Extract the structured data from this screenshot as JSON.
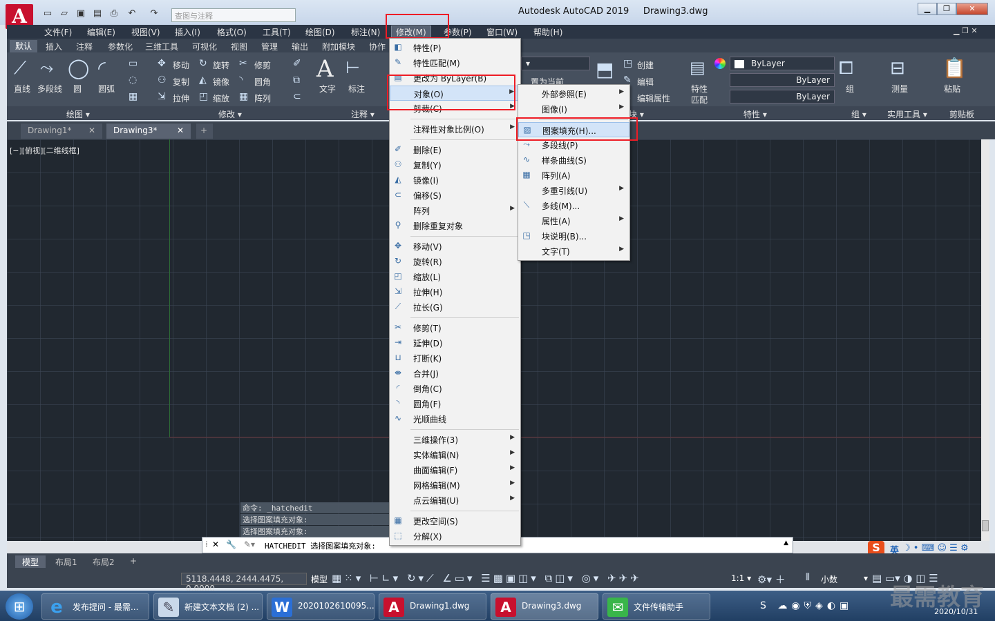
{
  "app": {
    "title": "Autodesk AutoCAD 2019",
    "file": "Drawing3.dwg",
    "search_placeholder": "查图与注释"
  },
  "menubar": [
    "文件(F)",
    "编辑(E)",
    "视图(V)",
    "插入(I)",
    "格式(O)",
    "工具(T)",
    "绘图(D)",
    "标注(N)",
    "修改(M)",
    "参数(P)",
    "窗口(W)",
    "帮助(H)"
  ],
  "ribbon_tabs": [
    "默认",
    "插入",
    "注释",
    "参数化",
    "三维工具",
    "可视化",
    "视图",
    "管理",
    "输出",
    "附加模块",
    "协作"
  ],
  "ribbon": {
    "draw": {
      "line": "直线",
      "pline": "多段线",
      "circle": "圆",
      "arc": "圆弧",
      "panel": "绘图"
    },
    "modify": {
      "move": "移动",
      "rotate": "旋转",
      "trim": "修剪",
      "copy": "复制",
      "mirror": "镜像",
      "fillet": "圆角",
      "stretch": "拉伸",
      "scale": "缩放",
      "array": "阵列",
      "panel": "修改"
    },
    "annotation": {
      "text": "文字",
      "dim": "标注",
      "panel": "注释"
    },
    "layer": {
      "setcurrent": "置为当前"
    },
    "block": {
      "create": "创建",
      "edit": "编辑",
      "editattr": "编辑属性",
      "panel": "块"
    },
    "props": {
      "match1": "特性",
      "match2": "匹配",
      "bylayer1": "ByLayer",
      "bylayer2": "ByLayer",
      "bylayer3": "ByLayer",
      "panel": "特性"
    },
    "group": {
      "group": "组",
      "panel": "组"
    },
    "utils": {
      "measure": "测量",
      "panel": "实用工具"
    },
    "clip": {
      "paste": "粘贴",
      "panel": "剪贴板"
    }
  },
  "doc_tabs": [
    "Drawing1*",
    "Drawing3*",
    "+"
  ],
  "viewport_label": "[−][俯视][二维线框]",
  "cmd_history": [
    "命令: _hatchedit",
    "选择图案填充对象:",
    "选择图案填充对象:"
  ],
  "cmd_input": "HATCHEDIT 选择图案填充对象:",
  "layout_tabs": [
    "模型",
    "布局1",
    "布局2",
    "+"
  ],
  "status": {
    "coords": "5118.4448, 2444.4475, 0.0000",
    "model": "模型",
    "scale": "1:1",
    "units": "小数"
  },
  "ime": {
    "lang": "英"
  },
  "taskbar": {
    "items": [
      "发布提问 - 最需...",
      "新建文本文档 (2) ...",
      "2020102610095...",
      "Drawing1.dwg",
      "Drawing3.dwg",
      "文件传输助手"
    ],
    "time": "2020/10/31"
  },
  "watermark": "最需教育",
  "modify_menu": {
    "items": [
      {
        "label": "特性(P)",
        "icon": "◧"
      },
      {
        "label": "特性匹配(M)",
        "icon": "✎"
      },
      {
        "label": "更改为 ByLayer(B)",
        "icon": "▤"
      },
      {
        "label": "对象(O)",
        "icon": "",
        "arrow": "▶"
      },
      {
        "label": "剪裁(C)",
        "icon": "",
        "arrow": "▶"
      },
      {
        "label": "注释性对象比例(O)",
        "icon": "",
        "arrow": "▶"
      },
      {
        "label": "删除(E)",
        "icon": "✐"
      },
      {
        "label": "复制(Y)",
        "icon": "⚇"
      },
      {
        "label": "镜像(I)",
        "icon": "◭"
      },
      {
        "label": "偏移(S)",
        "icon": "⊂"
      },
      {
        "label": "阵列",
        "icon": "",
        "arrow": "▶"
      },
      {
        "label": "删除重复对象",
        "icon": "⚲"
      },
      {
        "label": "移动(V)",
        "icon": "✥"
      },
      {
        "label": "旋转(R)",
        "icon": "↻"
      },
      {
        "label": "缩放(L)",
        "icon": "◰"
      },
      {
        "label": "拉伸(H)",
        "icon": "⇲"
      },
      {
        "label": "拉长(G)",
        "icon": "⟋"
      },
      {
        "label": "修剪(T)",
        "icon": "✂"
      },
      {
        "label": "延伸(D)",
        "icon": "⇥"
      },
      {
        "label": "打断(K)",
        "icon": "⊔"
      },
      {
        "label": "合并(J)",
        "icon": "⇼"
      },
      {
        "label": "倒角(C)",
        "icon": "◜"
      },
      {
        "label": "圆角(F)",
        "icon": "◝"
      },
      {
        "label": "光顺曲线",
        "icon": "∿"
      },
      {
        "label": "三维操作(3)",
        "icon": "",
        "arrow": "▶"
      },
      {
        "label": "实体编辑(N)",
        "icon": "",
        "arrow": "▶"
      },
      {
        "label": "曲面编辑(F)",
        "icon": "",
        "arrow": "▶"
      },
      {
        "label": "网格编辑(M)",
        "icon": "",
        "arrow": "▶"
      },
      {
        "label": "点云编辑(U)",
        "icon": "",
        "arrow": "▶"
      },
      {
        "label": "更改空间(S)",
        "icon": "▦"
      },
      {
        "label": "分解(X)",
        "icon": "⬚"
      }
    ]
  },
  "object_submenu": {
    "items": [
      {
        "label": "外部参照(E)",
        "icon": "",
        "arrow": "▶"
      },
      {
        "label": "图像(I)",
        "icon": "",
        "arrow": "▶"
      },
      {
        "label": "图案填充(H)...",
        "icon": "▨"
      },
      {
        "label": "多段线(P)",
        "icon": "⤳"
      },
      {
        "label": "样条曲线(S)",
        "icon": "∿"
      },
      {
        "label": "阵列(A)",
        "icon": "▦"
      },
      {
        "label": "多重引线(U)",
        "icon": "",
        "arrow": "▶"
      },
      {
        "label": "多线(M)...",
        "icon": "⟍"
      },
      {
        "label": "属性(A)",
        "icon": "",
        "arrow": "▶"
      },
      {
        "label": "块说明(B)...",
        "icon": "◳"
      },
      {
        "label": "文字(T)",
        "icon": "",
        "arrow": "▶"
      }
    ]
  }
}
